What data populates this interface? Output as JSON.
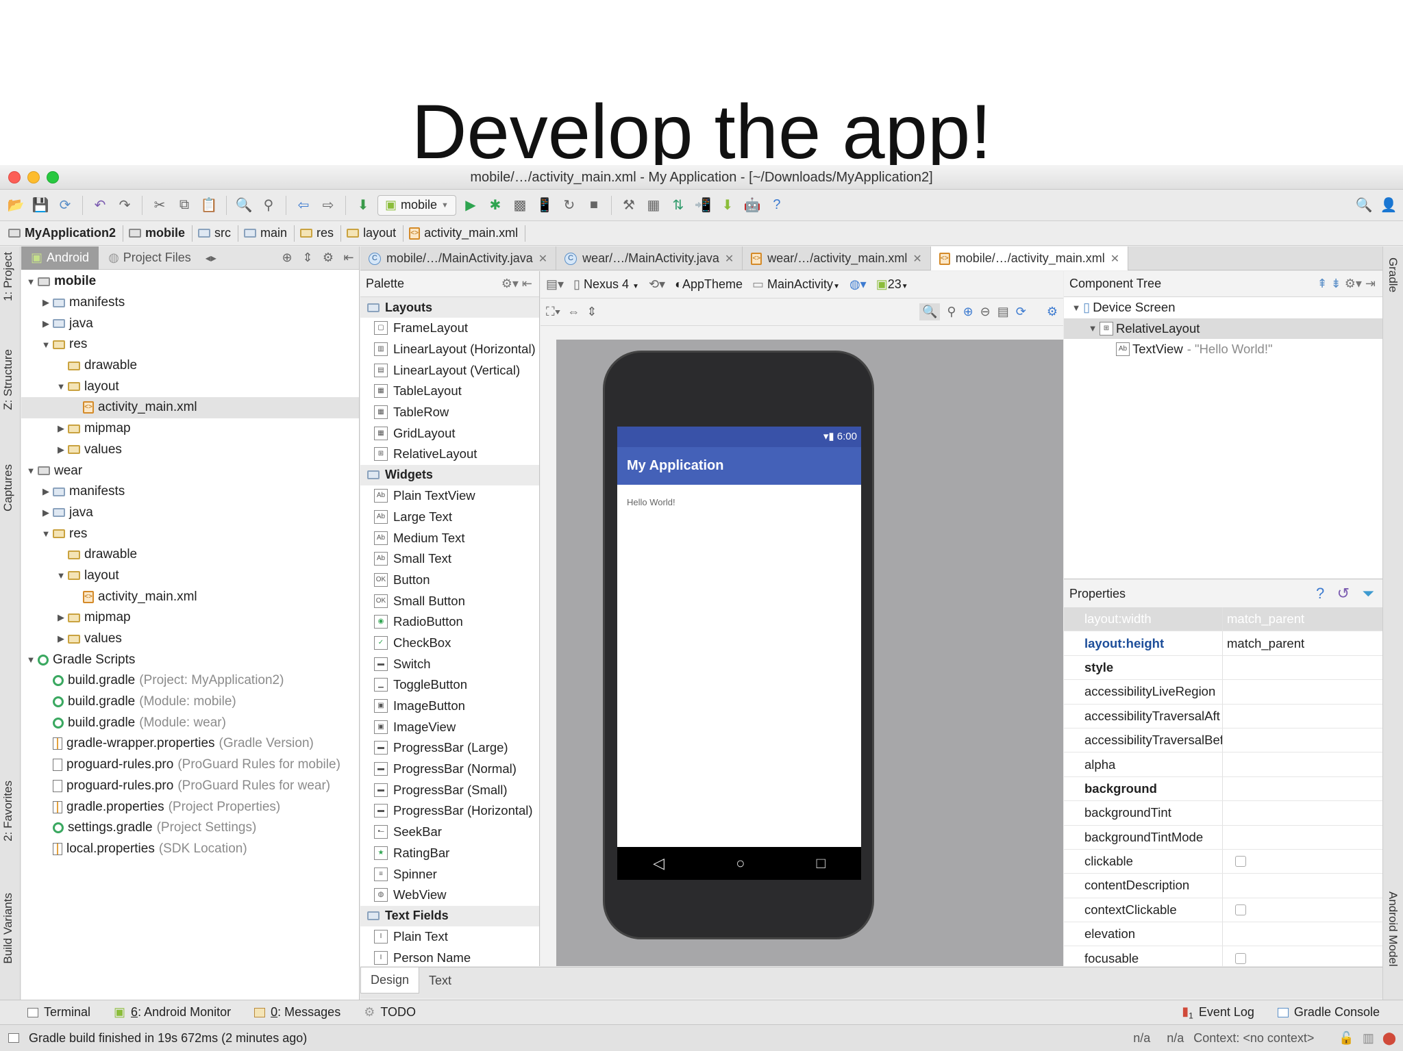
{
  "slide": {
    "title": "Develop the app!"
  },
  "window": {
    "title": "mobile/…/activity_main.xml - My Application - [~/Downloads/MyApplication2]"
  },
  "toolbar": {
    "run_config": "mobile"
  },
  "breadcrumb": [
    "MyApplication2",
    "mobile",
    "src",
    "main",
    "res",
    "layout",
    "activity_main.xml"
  ],
  "left_strip": {
    "project": "1: Project",
    "structure": "Z: Structure",
    "captures": "Captures",
    "favorites": "2: Favorites",
    "build_variants": "Build Variants"
  },
  "right_strip": {
    "gradle": "Gradle",
    "android_model": "Android Model"
  },
  "project_panel": {
    "tabs": [
      "Android",
      "Project Files"
    ],
    "tree": [
      {
        "label": "mobile",
        "depth": 0,
        "arrow": "▼",
        "icon": "module",
        "bold": true
      },
      {
        "label": "manifests",
        "depth": 1,
        "arrow": "▶",
        "icon": "folder"
      },
      {
        "label": "java",
        "depth": 1,
        "arrow": "▶",
        "icon": "folder"
      },
      {
        "label": "res",
        "depth": 1,
        "arrow": "▼",
        "icon": "res"
      },
      {
        "label": "drawable",
        "depth": 2,
        "arrow": "",
        "icon": "res"
      },
      {
        "label": "layout",
        "depth": 2,
        "arrow": "▼",
        "icon": "res"
      },
      {
        "label": "activity_main.xml",
        "depth": 3,
        "arrow": "",
        "icon": "xml",
        "selected": true
      },
      {
        "label": "mipmap",
        "depth": 2,
        "arrow": "▶",
        "icon": "res"
      },
      {
        "label": "values",
        "depth": 2,
        "arrow": "▶",
        "icon": "res"
      },
      {
        "label": "wear",
        "depth": 0,
        "arrow": "▼",
        "icon": "module"
      },
      {
        "label": "manifests",
        "depth": 1,
        "arrow": "▶",
        "icon": "folder"
      },
      {
        "label": "java",
        "depth": 1,
        "arrow": "▶",
        "icon": "folder"
      },
      {
        "label": "res",
        "depth": 1,
        "arrow": "▼",
        "icon": "res"
      },
      {
        "label": "drawable",
        "depth": 2,
        "arrow": "",
        "icon": "res"
      },
      {
        "label": "layout",
        "depth": 2,
        "arrow": "▼",
        "icon": "res"
      },
      {
        "label": "activity_main.xml",
        "depth": 3,
        "arrow": "",
        "icon": "xml"
      },
      {
        "label": "mipmap",
        "depth": 2,
        "arrow": "▶",
        "icon": "res"
      },
      {
        "label": "values",
        "depth": 2,
        "arrow": "▶",
        "icon": "res"
      },
      {
        "label": "Gradle Scripts",
        "depth": 0,
        "arrow": "▼",
        "icon": "gradle"
      },
      {
        "label": "build.gradle",
        "hint": "(Project: MyApplication2)",
        "depth": 1,
        "arrow": "",
        "icon": "gradle"
      },
      {
        "label": "build.gradle",
        "hint": "(Module: mobile)",
        "depth": 1,
        "arrow": "",
        "icon": "gradle"
      },
      {
        "label": "build.gradle",
        "hint": "(Module: wear)",
        "depth": 1,
        "arrow": "",
        "icon": "gradle"
      },
      {
        "label": "gradle-wrapper.properties",
        "hint": "(Gradle Version)",
        "depth": 1,
        "arrow": "",
        "icon": "prop"
      },
      {
        "label": "proguard-rules.pro",
        "hint": "(ProGuard Rules for mobile)",
        "depth": 1,
        "arrow": "",
        "icon": "file"
      },
      {
        "label": "proguard-rules.pro",
        "hint": "(ProGuard Rules for wear)",
        "depth": 1,
        "arrow": "",
        "icon": "file"
      },
      {
        "label": "gradle.properties",
        "hint": "(Project Properties)",
        "depth": 1,
        "arrow": "",
        "icon": "prop"
      },
      {
        "label": "settings.gradle",
        "hint": "(Project Settings)",
        "depth": 1,
        "arrow": "",
        "icon": "gradle"
      },
      {
        "label": "local.properties",
        "hint": "(SDK Location)",
        "depth": 1,
        "arrow": "",
        "icon": "prop"
      }
    ]
  },
  "editor_tabs": [
    {
      "label": "mobile/…/MainActivity.java",
      "icon": "class"
    },
    {
      "label": "wear/…/MainActivity.java",
      "icon": "class"
    },
    {
      "label": "wear/…/activity_main.xml",
      "icon": "xml"
    },
    {
      "label": "mobile/…/activity_main.xml",
      "icon": "xml",
      "active": true
    }
  ],
  "palette": {
    "title": "Palette",
    "groups": [
      {
        "name": "Layouts",
        "items": [
          "FrameLayout",
          "LinearLayout (Horizontal)",
          "LinearLayout (Vertical)",
          "TableLayout",
          "TableRow",
          "GridLayout",
          "RelativeLayout"
        ]
      },
      {
        "name": "Widgets",
        "items": [
          "Plain TextView",
          "Large Text",
          "Medium Text",
          "Small Text",
          "Button",
          "Small Button",
          "RadioButton",
          "CheckBox",
          "Switch",
          "ToggleButton",
          "ImageButton",
          "ImageView",
          "ProgressBar (Large)",
          "ProgressBar (Normal)",
          "ProgressBar (Small)",
          "ProgressBar (Horizontal)",
          "SeekBar",
          "RatingBar",
          "Spinner",
          "WebView"
        ]
      },
      {
        "name": "Text Fields",
        "items": [
          "Plain Text",
          "Person Name"
        ]
      }
    ]
  },
  "designer": {
    "device": "Nexus 4",
    "theme": "AppTheme",
    "activity": "MainActivity",
    "api": "23",
    "phone": {
      "time": "6:00",
      "app_title": "My Application",
      "content": "Hello World!"
    }
  },
  "component_tree": {
    "title": "Component Tree",
    "nodes": [
      {
        "label": "Device Screen",
        "depth": 0
      },
      {
        "label": "RelativeLayout",
        "depth": 1,
        "selected": true
      },
      {
        "label": "TextView",
        "hint": "- \"Hello World!\"",
        "depth": 2
      }
    ]
  },
  "properties": {
    "title": "Properties",
    "rows": [
      {
        "name": "layout:width",
        "value": "match_parent",
        "style": "selected"
      },
      {
        "name": "layout:height",
        "value": "match_parent",
        "style": "blue"
      },
      {
        "name": "style",
        "value": "",
        "style": "bold"
      },
      {
        "name": "accessibilityLiveRegion",
        "value": ""
      },
      {
        "name": "accessibilityTraversalAft",
        "value": ""
      },
      {
        "name": "accessibilityTraversalBef",
        "value": ""
      },
      {
        "name": "alpha",
        "value": ""
      },
      {
        "name": "background",
        "value": "",
        "style": "bold"
      },
      {
        "name": "backgroundTint",
        "value": ""
      },
      {
        "name": "backgroundTintMode",
        "value": ""
      },
      {
        "name": "clickable",
        "value": "",
        "checkbox": true
      },
      {
        "name": "contentDescription",
        "value": ""
      },
      {
        "name": "contextClickable",
        "value": "",
        "checkbox": true
      },
      {
        "name": "elevation",
        "value": ""
      },
      {
        "name": "focusable",
        "value": "",
        "checkbox": true
      }
    ]
  },
  "bottom_tabs": [
    "Design",
    "Text"
  ],
  "tool_windows": {
    "left": [
      {
        "prefix": "",
        "label": "Terminal"
      },
      {
        "prefix": "6",
        "label": ": Android Monitor"
      },
      {
        "prefix": "0",
        "label": ": Messages"
      },
      {
        "prefix": "",
        "label": "TODO"
      }
    ],
    "right": [
      {
        "label": "Event Log",
        "badge": "1"
      },
      {
        "label": "Gradle Console"
      }
    ]
  },
  "status": {
    "message": "Gradle build finished in 19s 672ms (2 minutes ago)",
    "pos1": "n/a",
    "pos2": "n/a",
    "context": "Context: <no context>"
  }
}
